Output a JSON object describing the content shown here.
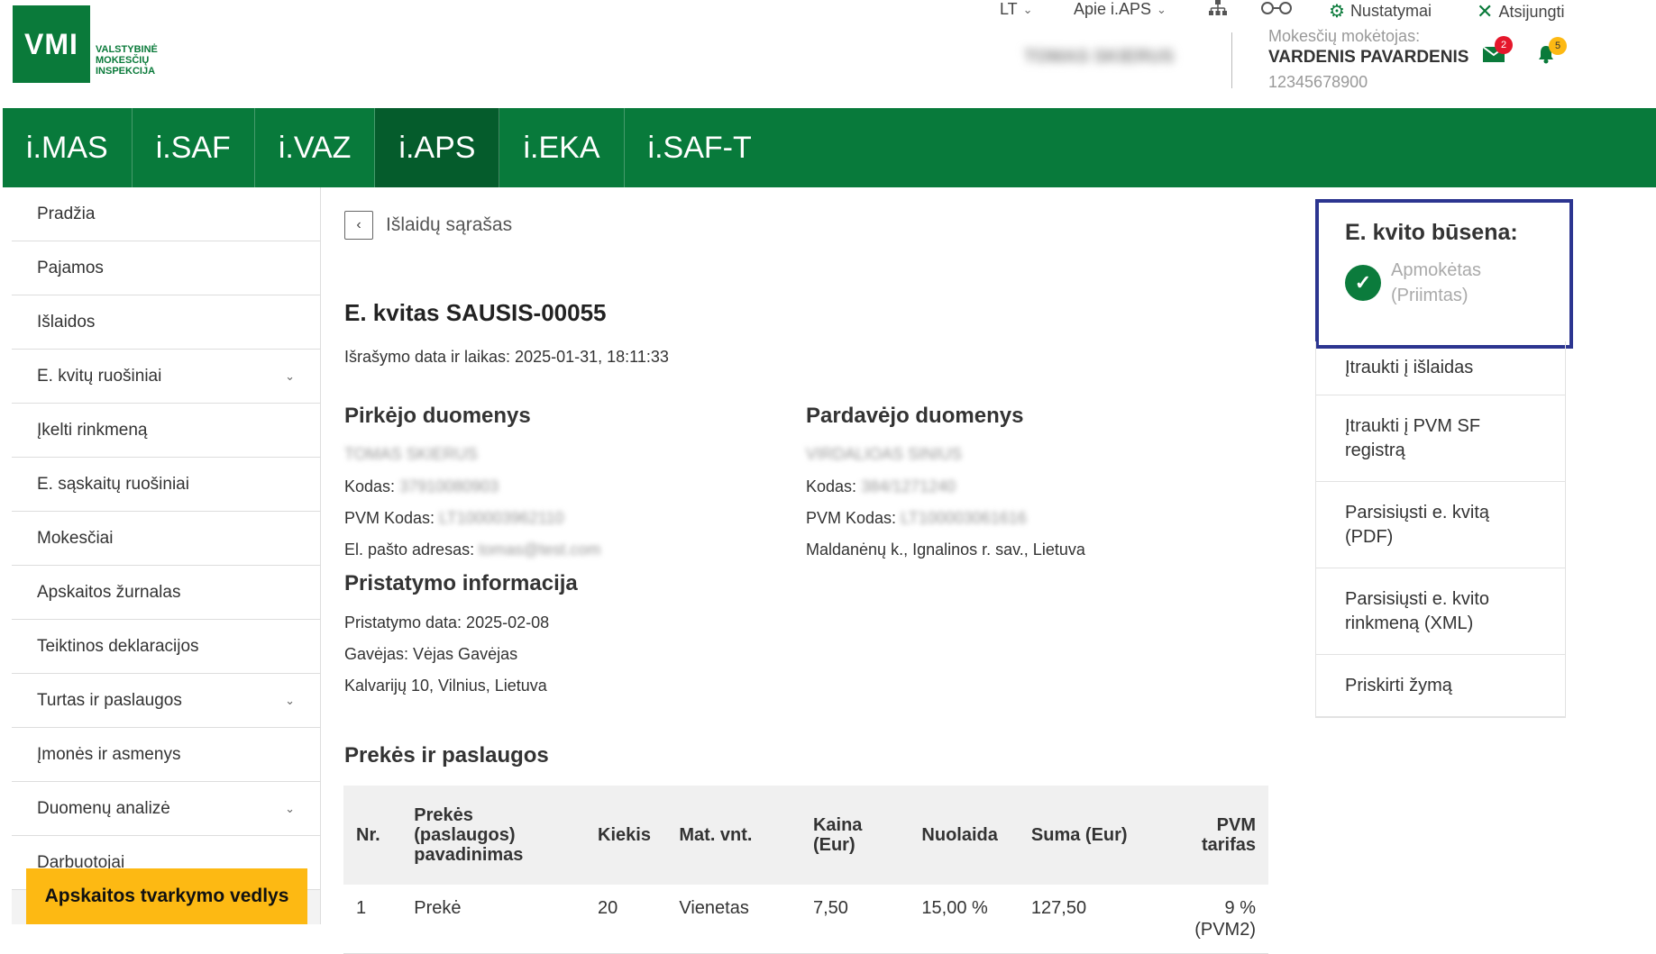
{
  "header": {
    "logo_mark": "VMI",
    "logo_line1": "VALSTYBINĖ",
    "logo_line2": "MOKESČIŲ",
    "logo_line3": "INSPEKCIJA",
    "lang": "LT",
    "about": "Apie i.APS",
    "settings": "Nustatymai",
    "logout": "Atsijungti",
    "user_name_blurred": "TOMAS SKIERUS",
    "taxpayer_label": "Mokesčių mokėtojas:",
    "taxpayer_name": "VARDENIS PAVARDENIS",
    "taxpayer_code": "12345678900",
    "messages_count": "2",
    "notifications_count": "5",
    "colors": {
      "brand": "#087a3b",
      "active": "#055c2c",
      "msg_badge": "#e5172b",
      "notif_badge": "#fdb913"
    }
  },
  "nav": {
    "tabs": [
      {
        "label": "i.MAS"
      },
      {
        "label": "i.SAF"
      },
      {
        "label": "i.VAZ"
      },
      {
        "label": "i.APS",
        "active": true
      },
      {
        "label": "i.EKA"
      },
      {
        "label": "i.SAF-T"
      }
    ]
  },
  "sidebar": {
    "items": [
      {
        "label": "Pradžia"
      },
      {
        "label": "Pajamos"
      },
      {
        "label": "Išlaidos"
      },
      {
        "label": "E. kvitų ruošiniai",
        "chevron": true
      },
      {
        "label": "Įkelti rinkmeną"
      },
      {
        "label": "E. sąskaitų ruošiniai"
      },
      {
        "label": "Mokesčiai"
      },
      {
        "label": "Apskaitos žurnalas"
      },
      {
        "label": "Teiktinos deklaracijos"
      },
      {
        "label": "Turtas ir paslaugos",
        "chevron": true
      },
      {
        "label": "Įmonės ir asmenys"
      },
      {
        "label": "Duomenų analizė",
        "chevron": true
      },
      {
        "label": "Darbuotojai"
      }
    ],
    "wizard": "Apskaitos tvarkymo vedlys"
  },
  "main": {
    "back_label": "Išlaidų sąrašas",
    "title": "E. kvitas SAUSIS-00055",
    "issued": "Išrašymo data ir laikas: 2025-01-31, 18:11:33",
    "buyer": {
      "title": "Pirkėjo duomenys",
      "name": "TOMAS SKIERUS",
      "code_label": "Kodas:",
      "code": "37910080903",
      "vat_label": "PVM Kodas:",
      "vat": "LT100003962110",
      "email_label": "El. pašto adresas:",
      "email": "tomas@test.com"
    },
    "seller": {
      "title": "Pardavėjo duomenys",
      "name": "VIRDALIOAS SINIUS",
      "code_label": "Kodas:",
      "code": "384/1271240",
      "vat_label": "PVM Kodas:",
      "vat": "LT100003061616",
      "address": "Maldanėnų k., Ignalinos r. sav., Lietuva"
    },
    "delivery": {
      "title": "Pristatymo informacija",
      "date": "Pristatymo data: 2025-02-08",
      "recipient": "Gavėjas: Vėjas Gavėjas",
      "address": "Kalvarijų 10, Vilnius, Lietuva"
    },
    "goods": {
      "title": "Prekės ir paslaugos",
      "headers": [
        "Nr.",
        "Prekės (paslaugos) pavadinimas",
        "Kiekis",
        "Mat. vnt.",
        "Kaina (Eur)",
        "Nuolaida",
        "Suma (Eur)",
        "PVM tarifas"
      ],
      "rows": [
        [
          "1",
          "Prekė",
          "20",
          "Vienetas",
          "7,50",
          "15,00 %",
          "127,50",
          "9 % (PVM2)"
        ]
      ]
    }
  },
  "status": {
    "title": "E. kvito būsena:",
    "value_line1": "Apmokėtas",
    "value_line2": "(Priimtas)"
  },
  "actions": [
    {
      "label": "Įtraukti į išlaidas"
    },
    {
      "label": "Įtraukti į PVM SF registrą"
    },
    {
      "label": "Parsisiųsti e. kvitą (PDF)"
    },
    {
      "label": "Parsisiųsti e. kvito rinkmeną (XML)"
    },
    {
      "label": "Priskirti žymą"
    }
  ]
}
